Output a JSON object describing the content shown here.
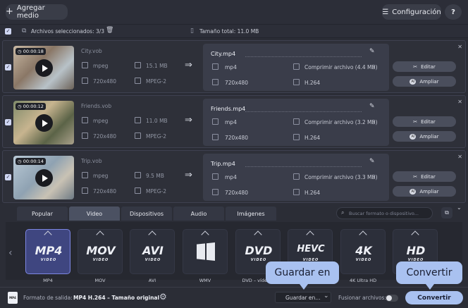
{
  "toolbar": {
    "add_media": "Agregar medio",
    "settings": "Configuración",
    "help": "?"
  },
  "selection": {
    "selected_label": "Archivos seleccionados: 3/3",
    "total_label": "Tamaño total: 11.0 MB"
  },
  "files": [
    {
      "duration": "00:00:18",
      "name": "City.vob",
      "container": "mpeg",
      "size": "15.1 MB",
      "resolution": "720x480",
      "codec": "MPEG-2",
      "out_name": "City.mp4",
      "out_container": "mp4",
      "out_compress": "Comprimir archivo (4.4 MB)",
      "out_resolution": "720x480",
      "out_codec": "H.264"
    },
    {
      "duration": "00:00:12",
      "name": "Friends.vob",
      "container": "mpeg",
      "size": "11.0 MB",
      "resolution": "720x480",
      "codec": "MPEG-2",
      "out_name": "Friends.mp4",
      "out_container": "mp4",
      "out_compress": "Comprimir archivo (3.2 MB)",
      "out_resolution": "720x480",
      "out_codec": "H.264"
    },
    {
      "duration": "00:00:14",
      "name": "Trip.vob",
      "container": "mpeg",
      "size": "9.5 MB",
      "resolution": "720x480",
      "codec": "MPEG-2",
      "out_name": "Trip.mp4",
      "out_container": "mp4",
      "out_compress": "Comprimir archivo (3.3 MB)",
      "out_resolution": "720x480",
      "out_codec": "H.264"
    }
  ],
  "row_actions": {
    "edit": "Editar",
    "enhance": "Ampliar"
  },
  "tabs": [
    "Popular",
    "Video",
    "Dispositivos",
    "Audio",
    "Imágenes"
  ],
  "search": {
    "placeholder": "Buscar formato o dispositivo..."
  },
  "formats": [
    {
      "logo": "MP4",
      "sub": "VIDEO",
      "label": "MP4"
    },
    {
      "logo": "MOV",
      "sub": "VIDEO",
      "label": "MOV"
    },
    {
      "logo": "AVI",
      "sub": "VIDEO",
      "label": "AVI"
    },
    {
      "logo": "",
      "sub": "",
      "label": "WMV"
    },
    {
      "logo": "DVD",
      "sub": "VIDEO",
      "label": "DVD – vídeo c"
    },
    {
      "logo": "HEVC",
      "sub": "VIDEO",
      "label": ""
    },
    {
      "logo": "4K",
      "sub": "VIDEO",
      "label": "4K Ultra HD"
    },
    {
      "logo": "HD",
      "sub": "VIDEO",
      "label": ""
    }
  ],
  "footer": {
    "output_label": "Formato de salida:",
    "output_value": "MP4 H.264 – Tamaño original",
    "save_in": "Guardar en...",
    "merge_label": "Fusionar archivos:",
    "convert": "Convertir"
  },
  "tooltips": {
    "save_in": "Guardar en",
    "convert": "Convertir"
  },
  "colors": {
    "accent": "#a9c1f0",
    "selected_format": "#3f4680"
  }
}
